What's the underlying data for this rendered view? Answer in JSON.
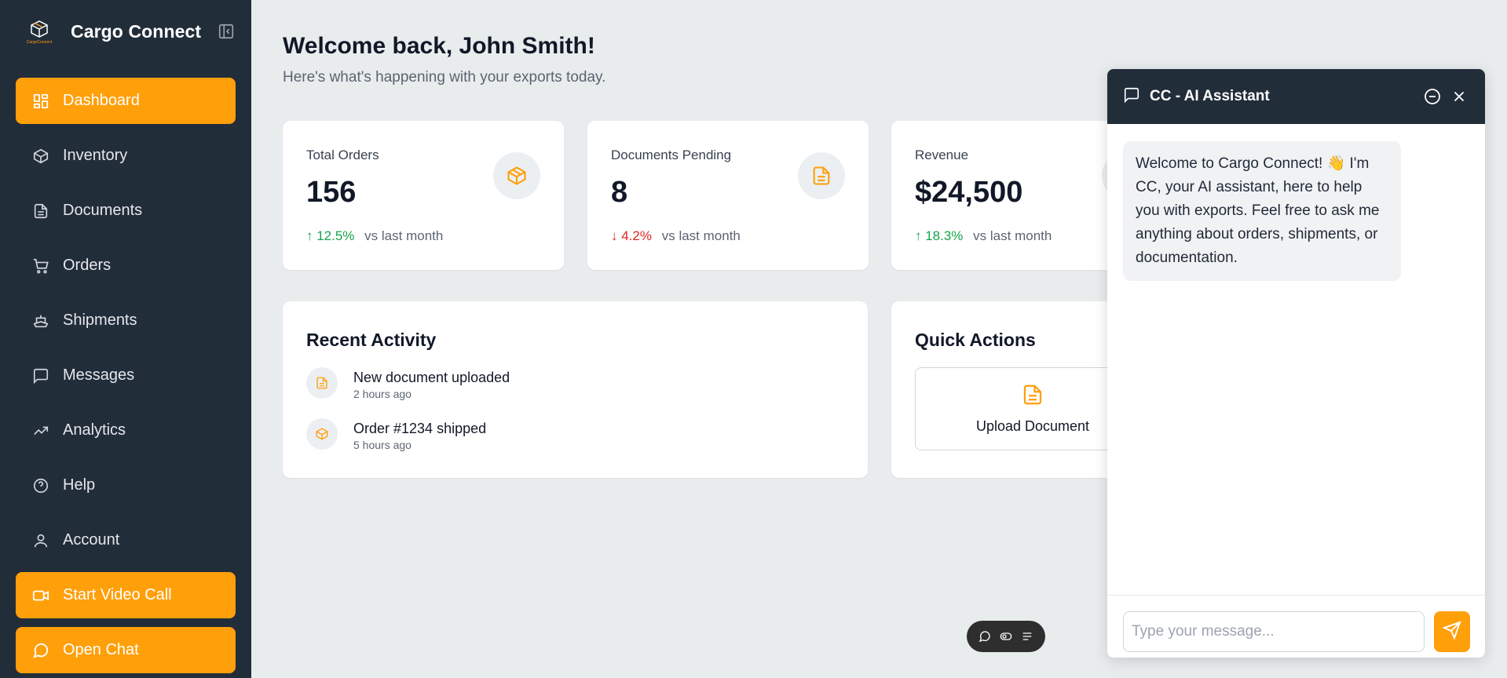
{
  "sidebar": {
    "brand": "Cargo Connect",
    "logo_text": "CargoConnect",
    "items": [
      {
        "label": "Dashboard",
        "icon": "dashboard-icon",
        "active": true
      },
      {
        "label": "Inventory",
        "icon": "box-icon"
      },
      {
        "label": "Documents",
        "icon": "document-icon"
      },
      {
        "label": "Orders",
        "icon": "cart-icon"
      },
      {
        "label": "Shipments",
        "icon": "ship-icon"
      },
      {
        "label": "Messages",
        "icon": "message-icon"
      },
      {
        "label": "Analytics",
        "icon": "trending-up-icon"
      },
      {
        "label": "Help",
        "icon": "help-circle-icon"
      },
      {
        "label": "Account",
        "icon": "user-icon"
      }
    ],
    "video_call": "Start Video Call",
    "open_chat": "Open Chat"
  },
  "header": {
    "title": "Welcome back, John Smith!",
    "subtitle": "Here's what's happening with your exports today."
  },
  "stats": [
    {
      "label": "Total Orders",
      "value": "156",
      "delta": "↑ 12.5%",
      "direction": "up",
      "note": "vs last month",
      "icon": "box-icon"
    },
    {
      "label": "Documents Pending",
      "value": "8",
      "delta": "↓ 4.2%",
      "direction": "down",
      "note": "vs last month",
      "icon": "document-icon"
    },
    {
      "label": "Revenue",
      "value": "$24,500",
      "delta": "↑ 18.3%",
      "direction": "up",
      "note": "vs last month",
      "icon": "dollar-icon"
    }
  ],
  "recent_activity": {
    "title": "Recent Activity",
    "items": [
      {
        "title": "New document uploaded",
        "time": "2 hours ago",
        "icon": "document-icon"
      },
      {
        "title": "Order #1234 shipped",
        "time": "5 hours ago",
        "icon": "box-icon"
      }
    ]
  },
  "quick_actions": {
    "title": "Quick Actions",
    "items": [
      {
        "label": "Upload Document",
        "icon": "document-icon"
      }
    ]
  },
  "chat": {
    "title": "CC - AI Assistant",
    "welcome": "Welcome to Cargo Connect! 👋 I'm CC, your AI assistant, here to help you with exports. Feel free to ask me anything about orders, shipments, or documentation.",
    "input_placeholder": "Type your message..."
  },
  "colors": {
    "accent": "#ff9f0a",
    "sidebar": "#222d3a",
    "background": "#e9eced",
    "positive": "#16a34a",
    "negative": "#dc2626"
  }
}
